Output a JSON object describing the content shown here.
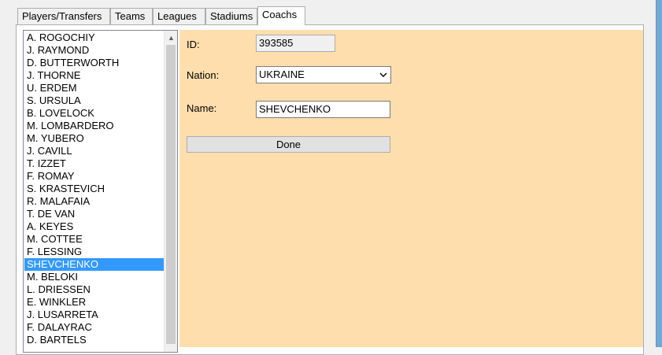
{
  "tabs": [
    {
      "label": "Players/Transfers"
    },
    {
      "label": "Teams"
    },
    {
      "label": "Leagues"
    },
    {
      "label": "Stadiums"
    },
    {
      "label": "Coachs"
    }
  ],
  "coach_list": {
    "selected_index": 18,
    "items": [
      "A. ROGOCHIY",
      "J. RAYMOND",
      "D. BUTTERWORTH",
      "J. THORNE",
      "U. ERDEM",
      "S. URSULA",
      "B. LOVELOCK",
      "M. LOMBARDERO",
      "M. YUBERO",
      "J. CAVILL",
      "T. IZZET",
      "F. ROMAY",
      "S. KRASTEVICH",
      "R. MALAFAIA",
      "T. DE VAN",
      "A. KEYES",
      "M. COTTEE",
      "F. LESSING",
      "SHEVCHENKO",
      "M. BELOKI",
      "L. DRIESSEN",
      "E. WINKLER",
      "J. LUSARRETA",
      "F. DALAYRAC",
      "D. BARTELS"
    ]
  },
  "form": {
    "id_label": "ID:",
    "id_value": "393585",
    "nation_label": "Nation:",
    "nation_value": "UKRAINE",
    "name_label": "Name:",
    "name_value": "SHEVCHENKO",
    "done_label": "Done"
  },
  "colors": {
    "form_background": "#ffdead",
    "selection": "#3399ff"
  }
}
